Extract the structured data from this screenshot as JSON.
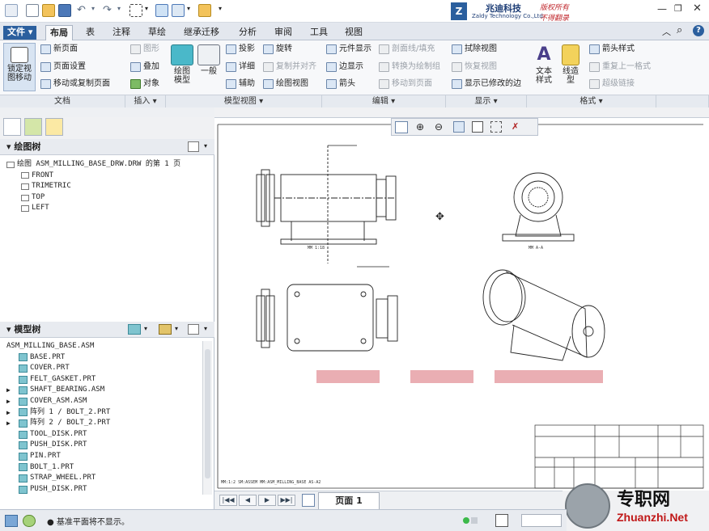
{
  "quick_access": {
    "items": [
      "new-icon",
      "open-icon",
      "save-icon",
      "undo-icon",
      "redo-icon",
      "select-box-icon",
      "regenerate-icon",
      "windows-icon",
      "close-window-icon",
      "customize-icon"
    ]
  },
  "brand": {
    "name_cn": "兆迪科技",
    "name_en": "Zaldy Technology Co.,Ltd.",
    "rights_1": "版权所有",
    "rights_2": "不得翻录"
  },
  "tabs": [
    "文件",
    "布局",
    "表",
    "注释",
    "草绘",
    "继承迁移",
    "分析",
    "审阅",
    "工具",
    "视图"
  ],
  "active_tab": "布局",
  "ribbon": {
    "lock_view": "锁定视\n图移动",
    "doc": {
      "new_page": "新页面",
      "page_setup": "页面设置",
      "move_copy": "移动或复制页面"
    },
    "insert": {
      "graphic": "图形",
      "overlay": "叠加",
      "object": "对象"
    },
    "model_view": {
      "drawing_model": "绘图\n模型",
      "general": "一般",
      "projection": "投影",
      "detailed": "详细",
      "auxiliary": "辅助",
      "rotate": "旋转",
      "copy_align": "复制并对齐",
      "drawing_view": "绘图视图"
    },
    "edit": {
      "element_display": "元件显示",
      "edge_display": "边显示",
      "arrow": "箭头",
      "section_line": "剖面线/填充",
      "convert": "转换为绘制组",
      "move_page": "移动到页面"
    },
    "display": {
      "erase_view": "拭除视图",
      "restore_view": "恢复视图",
      "show_modified": "显示已修改的边"
    },
    "format": {
      "text_style": "文本\n样式",
      "line_style": "线造\n型",
      "arrow_style": "箭头样式",
      "repeat_format": "重复上一格式",
      "hyperlink": "超级链接"
    }
  },
  "groups": [
    "文档",
    "插入 ▾",
    "模型视图 ▾",
    "编辑 ▾",
    "显示 ▾",
    "格式 ▾"
  ],
  "draw_tree": {
    "title": "绘图树",
    "root": "绘图 ASM_MILLING_BASE_DRW.DRW 的第 1 页",
    "views": [
      "FRONT",
      "TRIMETRIC",
      "TOP",
      "LEFT"
    ]
  },
  "model_tree": {
    "title": "模型树",
    "root": "ASM_MILLING_BASE.ASM",
    "items": [
      {
        "label": "BASE.PRT",
        "expand": false
      },
      {
        "label": "COVER.PRT",
        "expand": false
      },
      {
        "label": "FELT_GASKET.PRT",
        "expand": false
      },
      {
        "label": "SHAFT_BEARING.ASM",
        "expand": true
      },
      {
        "label": "COVER_ASM.ASM",
        "expand": true
      },
      {
        "label": "阵列 1 / BOLT_2.PRT",
        "expand": true
      },
      {
        "label": "阵列 2 / BOLT_2.PRT",
        "expand": true
      },
      {
        "label": "TOOL_DISK.PRT",
        "expand": false
      },
      {
        "label": "PUSH_DISK.PRT",
        "expand": false
      },
      {
        "label": "PIN.PRT",
        "expand": false
      },
      {
        "label": "BOLT_1.PRT",
        "expand": false
      },
      {
        "label": "STRAP_WHEEL.PRT",
        "expand": false
      },
      {
        "label": "PUSH_DISK.PRT",
        "expand": false
      }
    ]
  },
  "drawing": {
    "scale_left": "MM 1:18",
    "section_label": "MM A-A",
    "bottom_info": "MM:1:2      SM:ASSEM    MM:ASM_MILLING_BASE  AS-A2"
  },
  "sheet": {
    "page_label": "页面 1"
  },
  "status": {
    "message": "基准平面将不显示。"
  },
  "watermark": {
    "cn": "专职网",
    "url": "Zhuanzhi.Net"
  }
}
